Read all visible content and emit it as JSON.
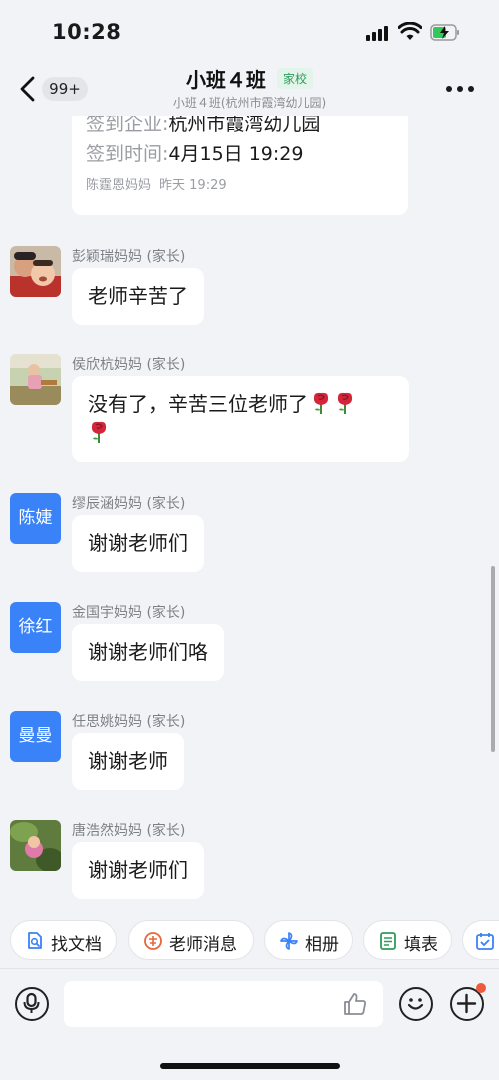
{
  "status": {
    "time": "10:28"
  },
  "header": {
    "unread_count": "99+",
    "title": "小班４班",
    "tag": "家校",
    "subtitle": "小班４班(杭州市霞湾幼儿园)"
  },
  "card": {
    "company_key": "签到企业:",
    "company_val": "杭州市霞湾幼儿园",
    "time_key": "签到时间:",
    "time_val": "4月15日 19:29",
    "sender": "陈霆恩妈妈",
    "when": "昨天 19:29"
  },
  "messages": [
    {
      "sender": "彭颖瑞妈妈 (家长)",
      "text": "老师辛苦了",
      "avatar": "photo"
    },
    {
      "sender": "侯欣杭妈妈 (家长)",
      "text": "没有了，辛苦三位老师了",
      "avatar": "photo",
      "emoji": "rose-emoji"
    },
    {
      "sender": "缪辰涵妈妈 (家长)",
      "text": "谢谢老师们",
      "avatar_text": "陈婕"
    },
    {
      "sender": "金国宇妈妈 (家长)",
      "text": "谢谢老师们咯",
      "avatar_text": "徐红"
    },
    {
      "sender": "任思姚妈妈 (家长)",
      "text": "谢谢老师",
      "avatar_text": "曼曼"
    },
    {
      "sender": "唐浩然妈妈 (家长)",
      "text": "谢谢老师们",
      "avatar": "photo"
    }
  ],
  "quick_actions": [
    {
      "label": "找文档",
      "icon": "doc-search-icon"
    },
    {
      "label": "老师消息",
      "icon": "teacher-icon"
    },
    {
      "label": "相册",
      "icon": "pinwheel-icon"
    },
    {
      "label": "填表",
      "icon": "form-icon"
    },
    {
      "label": "",
      "icon": "calendar-check-icon"
    }
  ],
  "input": {
    "value": "",
    "placeholder": ""
  },
  "colors": {
    "accent": "#3a82f7",
    "tag_green": "#2f9b5c",
    "notify_dot": "#f05a3c"
  }
}
